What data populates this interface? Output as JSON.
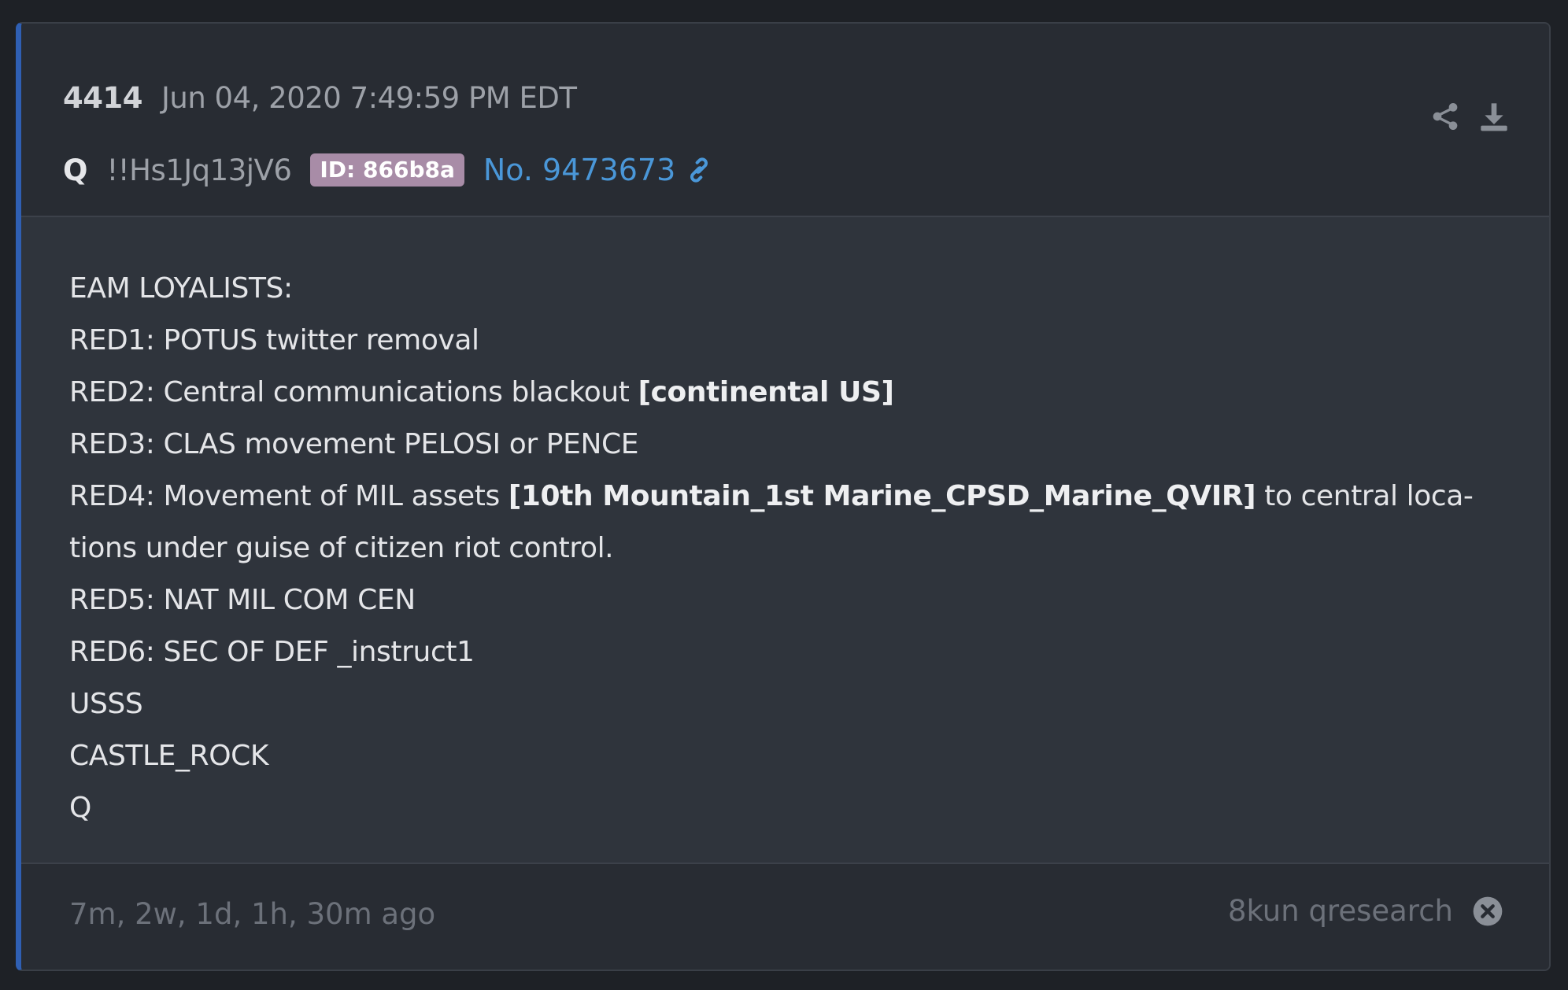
{
  "post": {
    "number": "4414",
    "date": "Jun 04, 2020 7:49:59 PM EDT",
    "author": "Q",
    "tripcode": "!!Hs1Jq13jV6",
    "id_badge": "ID: 866b8a",
    "post_link": "No. 9473673"
  },
  "header_icons": [
    "share-icon",
    "download-icon",
    "link-icon"
  ],
  "message": {
    "line1": "EAM LOYALISTS:",
    "line2": "RED1: POTUS twitter removal",
    "line3_a": "RED2: Central communications blackout ",
    "line3_b": "[continental US]",
    "line4": "RED3: CLAS movement PELOSI or PENCE",
    "line5_a": "RED4: Movement of MIL assets ",
    "line5_b": "[10th Mountain_1st Marine_CPSD_Marine_QVIR]",
    "line5_c": " to central loca-",
    "line6": "tions under guise of citizen riot control.",
    "line7": "RED5: NAT MIL COM CEN",
    "line8": "RED6: SEC OF DEF _instruct1",
    "line9": "USSS",
    "line10": "CASTLE_ROCK",
    "line11": "Q"
  },
  "footer": {
    "time_ago": "7m, 2w, 1d, 1h, 30m ago",
    "source": "8kun qresearch"
  },
  "colors": {
    "page_bg": "#1e2126",
    "card_bg": "#282c33",
    "body_bg": "#2f343c",
    "accent_border": "#2f5fb3",
    "id_badge_bg": "#a88ca7",
    "link": "#4a97d8"
  }
}
